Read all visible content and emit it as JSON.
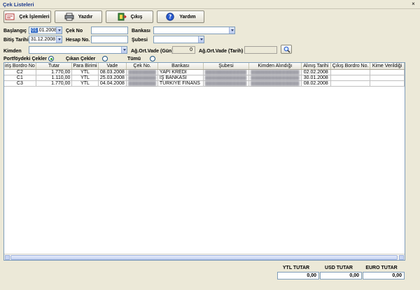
{
  "window": {
    "title": "Çek Listeleri",
    "close_glyph": "×"
  },
  "toolbar": {
    "islemler": {
      "label": "Çek İşlemleri",
      "icon": "cheque-icon"
    },
    "yazdir": {
      "label": "Yazdır",
      "icon": "printer-icon"
    },
    "cikis": {
      "label": "Çıkış",
      "icon": "exit-icon"
    },
    "yardim": {
      "label": "Yardım",
      "icon": "help-icon"
    }
  },
  "filters": {
    "baslangic_label": "Başlangıç",
    "baslangic_day": "01",
    "baslangic_rest": ".01.2008",
    "bitis_label": "Bitiş Tarihi",
    "bitis_value": "31.12.2008",
    "cekno_label": "Çek No",
    "cekno_value": "",
    "hesapno_label": "Hesap No.",
    "hesapno_value": "",
    "bankasi_label": "Bankası",
    "bankasi_value": "",
    "subesi_label": "Şubesi",
    "subesi_value": "",
    "kimden_label": "Kimden",
    "kimden_value": "",
    "agort_gun_label": "Ağ.Ort.Vade (Gün)",
    "agort_gun_value": "0",
    "agort_tarih_label": "Ağ.Ort.Vade (Tarih)",
    "agort_tarih_value": ""
  },
  "radios": {
    "portfoy": {
      "label": "Portföydeki Çekler",
      "checked": true
    },
    "cikan": {
      "label": "Çıkan Çekler",
      "checked": false
    },
    "tumu": {
      "label": "Tümü",
      "checked": false
    }
  },
  "table": {
    "columns": [
      "iriş Bordro No",
      "Tutar",
      "Para Birimi",
      "Vade",
      "Çek No.",
      "Bankası",
      "Şubesi",
      "Kimden Alındığı",
      "Alınış Tarihi",
      "Çıkış Bordro No.",
      "Kime Verildiği"
    ],
    "rows": [
      {
        "bordro": "C2",
        "tutar": "1.770,00",
        "birim": "YTL",
        "vade": "08.03.2008",
        "cekno": "████████",
        "banka": "YAPI KREDİ",
        "sube": "████████████",
        "kimden": "██████████████",
        "alinis": "02.02.2008",
        "cikis": "",
        "kime": ""
      },
      {
        "bordro": "C1",
        "tutar": "1.110,00",
        "birim": "YTL",
        "vade": "25.03.2008",
        "cekno": "████████",
        "banka": "İŞ BANKASI",
        "sube": "████████████",
        "kimden": "██████████████",
        "alinis": "30.01.2008",
        "cikis": "",
        "kime": ""
      },
      {
        "bordro": "C3",
        "tutar": "1.770,00",
        "birim": "YTL",
        "vade": "04.04.2008",
        "cekno": "████████",
        "banka": "TÜRKİYE FİNANS",
        "sube": "████████████",
        "kimden": "██████████████",
        "alinis": "08.02.2008",
        "cikis": "",
        "kime": ""
      }
    ]
  },
  "totals": {
    "ytl_label": "YTL TUTAR",
    "ytl_value": "0,00",
    "usd_label": "USD TUTAR",
    "usd_value": "0,00",
    "euro_label": "EURO TUTAR",
    "euro_value": "0,00"
  },
  "colors": {
    "window_bg": "#ece9d8",
    "title_text": "#1d3b8f",
    "selection": "#316ac5"
  }
}
